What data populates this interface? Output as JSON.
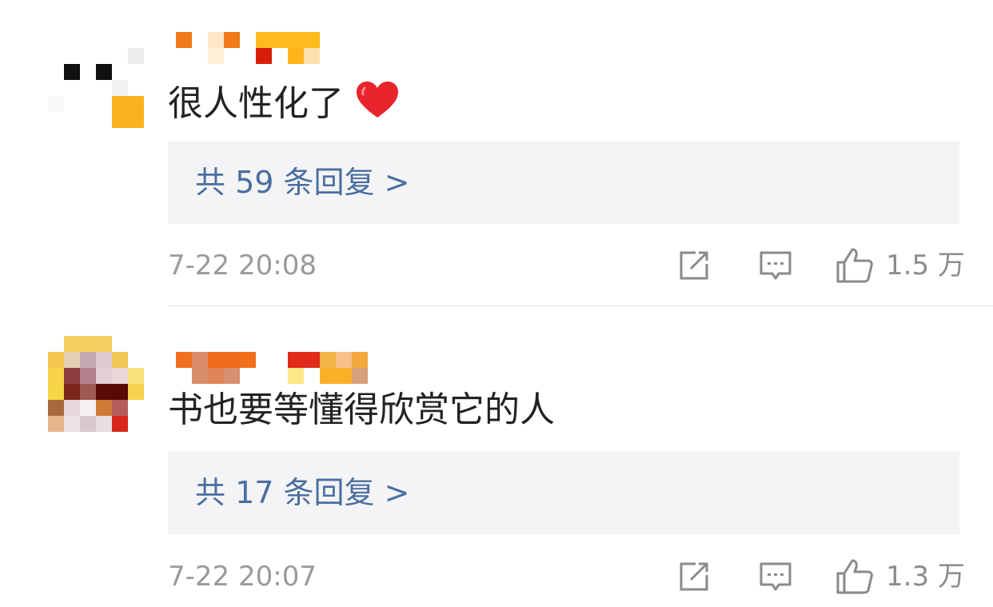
{
  "comments": [
    {
      "text": "很人性化了",
      "emoji": "heart-icon",
      "replies_label": "共 59 条回复 >",
      "timestamp": "7-22 20:08",
      "likes": "1.5 万"
    },
    {
      "text": "书也要等懂得欣赏它的人",
      "replies_label": "共 17 条回复 >",
      "timestamp": "7-22 20:07",
      "likes": "1.3 万"
    }
  ],
  "colors": {
    "reply_link": "#4a6fa0",
    "reply_bg": "#f4f4f6",
    "meta_gray": "#9a9a9a",
    "heart": "#e8242c"
  }
}
